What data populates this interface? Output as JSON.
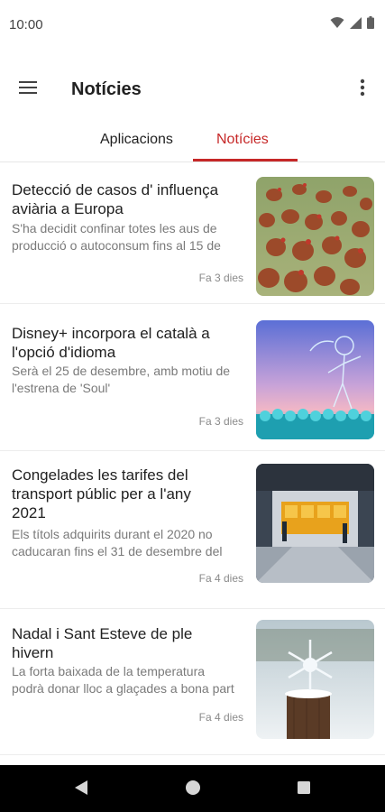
{
  "status_bar": {
    "time": "10:00",
    "icons": [
      "wifi-icon",
      "signal-icon",
      "battery-icon"
    ]
  },
  "app_bar": {
    "title": "Notícies",
    "menu_icon": "hamburger-menu-icon",
    "more_icon": "more-vertical-icon"
  },
  "tabs": [
    {
      "label": "Aplicacions",
      "selected": false
    },
    {
      "label": "Notícies",
      "selected": true
    }
  ],
  "colors": {
    "accent": "#c62828",
    "text": "#212121",
    "secondary_text": "#7a7a7a"
  },
  "news": [
    {
      "title_lines": [
        "Detecció de casos d' influença",
        "aviària a Europa"
      ],
      "desc_lines": [
        "S'ha decidit confinar totes les aus de",
        "producció o autoconsum fins al 15 de"
      ],
      "time": "Fa 3 dies",
      "image": "chickens-photo"
    },
    {
      "title_lines": [
        "Disney+ incorpora el català a",
        "l'opció d'idioma"
      ],
      "desc_lines": [
        "Serà el 25 de desembre, amb motiu de",
        "l'estrena de 'Soul'"
      ],
      "time": "Fa 3 dies",
      "image": "soul-movie-photo"
    },
    {
      "title_lines": [
        "Congelades les tarifes del",
        "transport públic per a l'any",
        "2021"
      ],
      "desc_lines": [
        "Els títols adquirits durant el 2020 no",
        "caducaran fins el 31 de desembre del"
      ],
      "time": "Fa 4 dies",
      "image": "metro-station-photo"
    },
    {
      "title_lines": [
        "Nadal i Sant Esteve de ple",
        "hivern"
      ],
      "desc_lines": [
        "La forta baixada de la temperatura",
        "podrà donar lloc a glaçades a bona part"
      ],
      "time": "Fa 4 dies",
      "image": "snowflake-photo"
    }
  ],
  "nav_bar": {
    "icons": [
      "back-icon",
      "home-icon",
      "recents-icon"
    ]
  }
}
